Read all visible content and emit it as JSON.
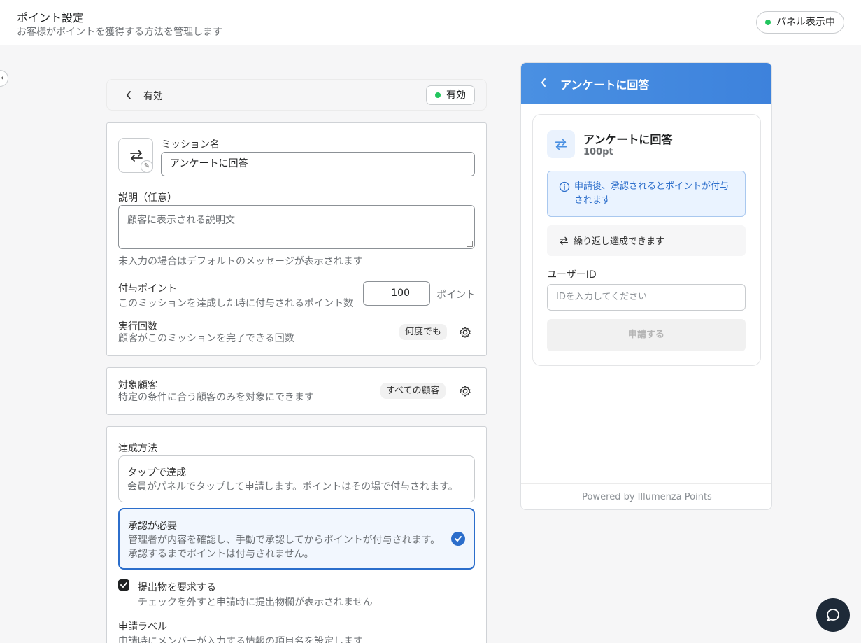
{
  "header": {
    "title": "ポイント設定",
    "subtitle": "お客様がポイントを獲得する方法を管理します",
    "panel_status": "パネル表示中"
  },
  "status_bar": {
    "label": "有効",
    "badge": "有効"
  },
  "mission": {
    "name_label": "ミッション名",
    "name_value": "アンケートに回答",
    "description_label": "説明（任意）",
    "description_placeholder": "顧客に表示される説明文",
    "description_hint": "未入力の場合はデフォルトのメッセージが表示されます",
    "points_label": "付与ポイント",
    "points_hint": "このミッションを達成した時に付与されるポイント数",
    "points_value": "100",
    "points_unit": "ポイント",
    "runs_label": "実行回数",
    "runs_hint": "顧客がこのミッションを完了できる回数",
    "runs_value": "何度でも"
  },
  "target": {
    "label": "対象顧客",
    "hint": "特定の条件に合う顧客のみを対象にできます",
    "value": "すべての顧客"
  },
  "achievement": {
    "label": "達成方法",
    "options": [
      {
        "title": "タップで達成",
        "desc": "会員がパネルでタップして申請します。ポイントはその場で付与されます。",
        "selected": false
      },
      {
        "title": "承認が必要",
        "desc": "管理者が内容を確認し、手動で承認してからポイントが付与されます。",
        "desc2": "承認するまでポイントは付与されません。",
        "selected": true
      }
    ],
    "require_submission_label": "提出物を要求する",
    "require_submission_hint": "チェックを外すと申請時に提出物欄が表示されません",
    "require_submission_checked": true,
    "apply_label": "申請ラベル",
    "apply_hint": "申請時にメンバーが入力する情報の項目名を設定します"
  },
  "preview": {
    "header_title": "アンケートに回答",
    "mission_name": "アンケートに回答",
    "mission_points": "100pt",
    "info_text": "申請後、承認されるとポイントが付与されます",
    "repeat_text": "繰り返し達成できます",
    "user_id_label": "ユーザーID",
    "user_id_placeholder": "IDを入力してください",
    "submit_label": "申請する",
    "footer": "Powered by Illumenza Points"
  },
  "colors": {
    "accent": "#2c6ecb",
    "preview_header": "#4a90e2",
    "status_green": "#22c55e",
    "chat_button": "#1e2a38"
  }
}
